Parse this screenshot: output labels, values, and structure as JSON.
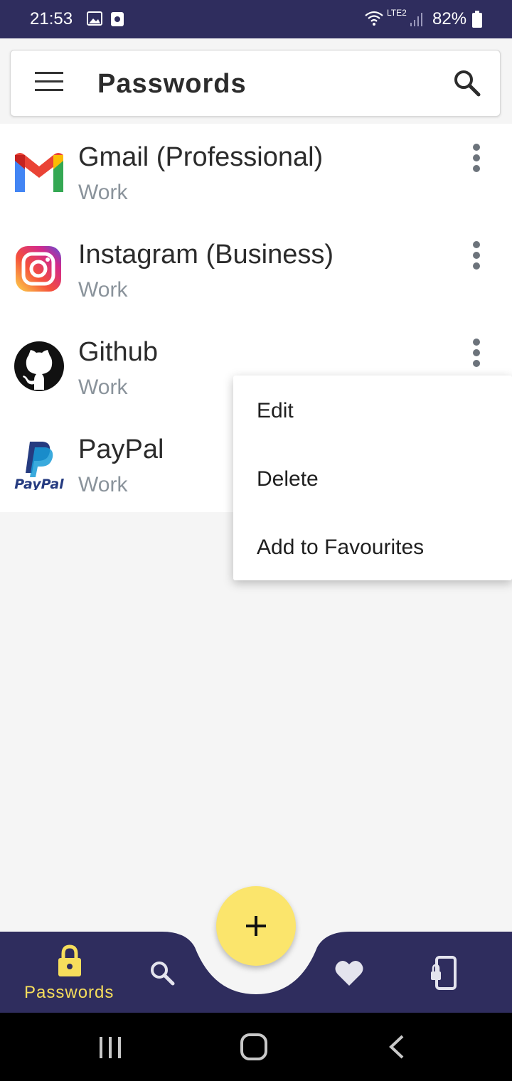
{
  "status_bar": {
    "time": "21:53",
    "battery": "82%",
    "network": "LTE2"
  },
  "header": {
    "title": "Passwords",
    "menu_icon": "hamburger-menu-icon",
    "search_icon": "search-icon"
  },
  "passwords": [
    {
      "name": "Gmail (Professional)",
      "category": "Work",
      "icon": "gmail-logo"
    },
    {
      "name": "Instagram (Business)",
      "category": "Work",
      "icon": "instagram-logo"
    },
    {
      "name": "Github",
      "category": "Work",
      "icon": "github-logo"
    },
    {
      "name": "PayPal",
      "category": "Work",
      "icon": "paypal-logo",
      "logo_text": "PayPal"
    }
  ],
  "context_menu": {
    "items": [
      "Edit",
      "Delete",
      "Add to Favourites"
    ]
  },
  "bottom_nav": {
    "passwords_label": "Passwords",
    "fab_icon": "plus-icon",
    "items": [
      "lock-icon",
      "search-icon",
      "heart-icon",
      "phone-lock-icon"
    ]
  },
  "colors": {
    "primary": "#2f2d5e",
    "accent": "#f7de5c",
    "fab": "#fbe56c"
  }
}
